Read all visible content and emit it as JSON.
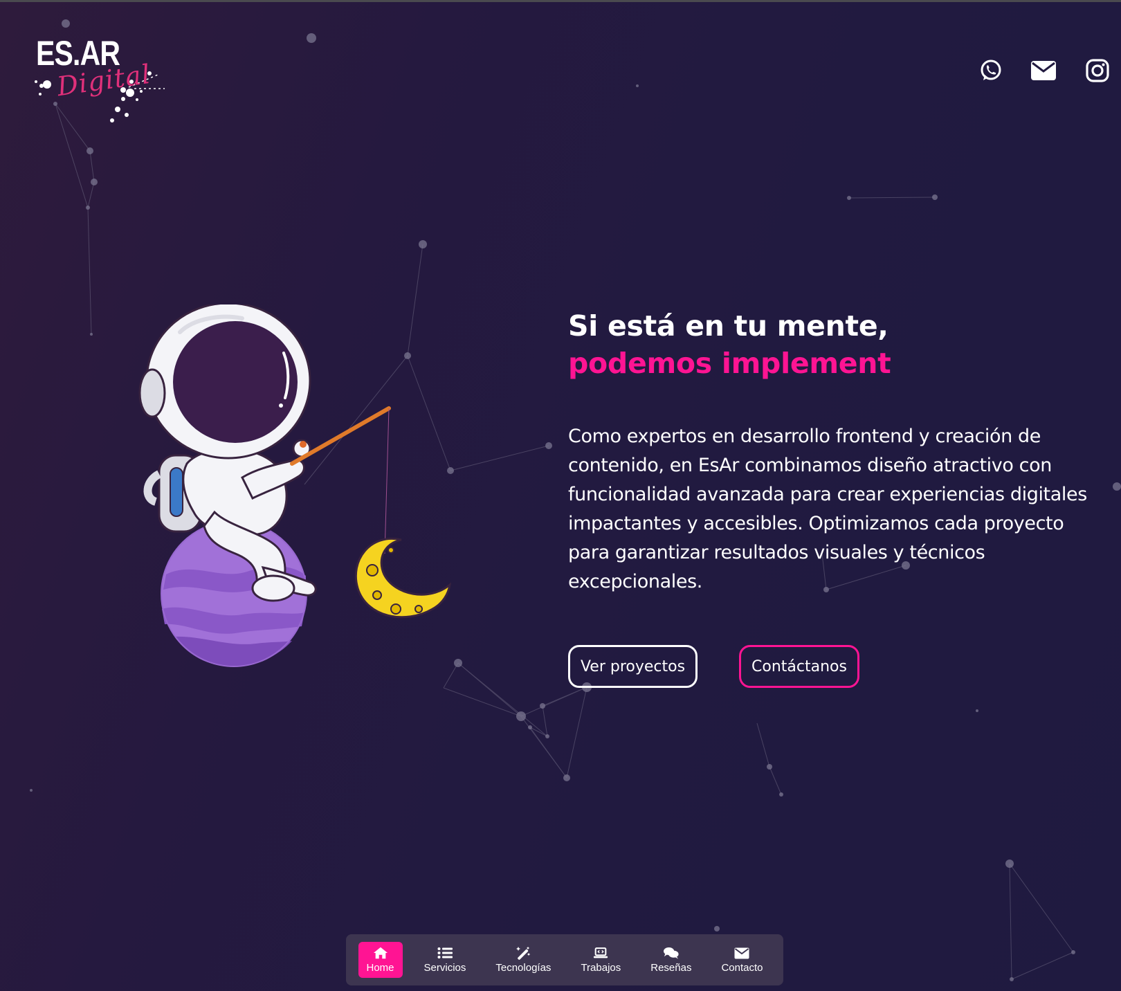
{
  "brand": {
    "logo_main": "ES.AR",
    "logo_sub": "Digital"
  },
  "social": [
    {
      "icon": "whatsapp-icon"
    },
    {
      "icon": "mail-icon"
    },
    {
      "icon": "instagram-icon"
    }
  ],
  "hero": {
    "headline": "Si está en tu mente,",
    "headline_accent": "podemos implement",
    "description": "Como expertos en desarrollo frontend y creación de contenido, en EsAr combinamos diseño atractivo con funcionalidad avanzada para crear experiencias digitales impactantes y accesibles. Optimizamos cada proyecto para garantizar resultados visuales y técnicos excepcionales.",
    "btn_projects": "Ver proyectos",
    "btn_contact": "Contáctanos",
    "illustration": "astronaut-fishing-moon-illustration"
  },
  "nav": {
    "items": [
      {
        "label": "Home",
        "icon": "home-icon",
        "active": true
      },
      {
        "label": "Servicios",
        "icon": "list-icon",
        "active": false
      },
      {
        "label": "Tecnologías",
        "icon": "magic-wand-icon",
        "active": false
      },
      {
        "label": "Trabajos",
        "icon": "laptop-code-icon",
        "active": false
      },
      {
        "label": "Reseñas",
        "icon": "comments-icon",
        "active": false
      },
      {
        "label": "Contacto",
        "icon": "envelope-icon",
        "active": false
      }
    ]
  },
  "colors": {
    "accent": "#ff1493",
    "background": "#221a40",
    "navbar": "#3d3550",
    "text": "#ffffff"
  }
}
